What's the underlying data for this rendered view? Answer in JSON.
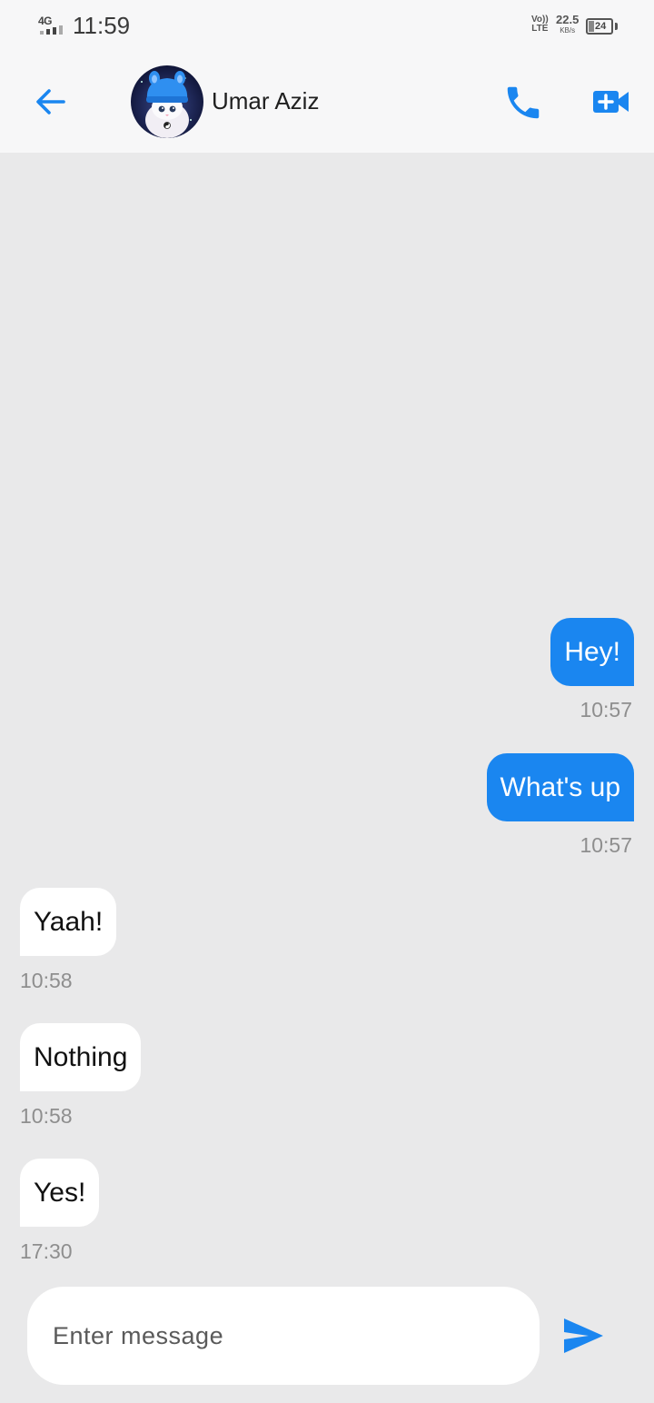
{
  "status_bar": {
    "network_type": "4G",
    "time": "11:59",
    "volte": [
      "Vo))",
      "LTE"
    ],
    "net_speed": "22.5",
    "net_speed_unit": "KB/s",
    "battery_level": "24"
  },
  "header": {
    "contact_name": "Umar Aziz",
    "icons": {
      "back": "arrow-left-icon",
      "call": "phone-icon",
      "video": "video-call-icon"
    }
  },
  "messages": [
    {
      "direction": "outgoing",
      "text": "Hey!",
      "time": "10:57"
    },
    {
      "direction": "outgoing",
      "text": "What's up",
      "time": "10:57"
    },
    {
      "direction": "incoming",
      "text": "Yaah!",
      "time": "10:58"
    },
    {
      "direction": "incoming",
      "text": "Nothing",
      "time": "10:58"
    },
    {
      "direction": "incoming",
      "text": "Yes!",
      "time": "17:30"
    }
  ],
  "composer": {
    "placeholder": "Enter message",
    "value": "",
    "send_icon": "send-icon"
  },
  "colors": {
    "accent": "#1a86f0",
    "chat_background": "#e9e9ea",
    "bar_background": "#f7f7f8",
    "incoming_bubble": "#ffffff",
    "timestamp": "#8e8e8e"
  }
}
